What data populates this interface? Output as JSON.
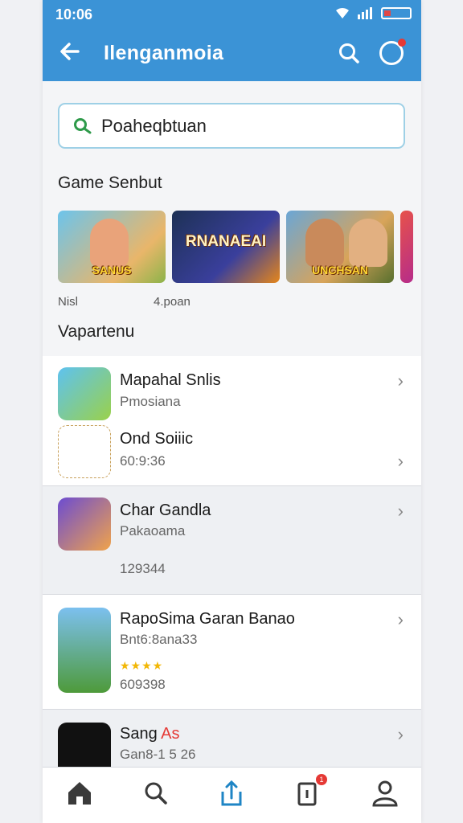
{
  "status": {
    "time": "10:06"
  },
  "header": {
    "title": "Ilenganmoia"
  },
  "search": {
    "value": "Poaheqbtuan"
  },
  "featured": {
    "title": "Game Senbut",
    "items": [
      {
        "label": "SANUS"
      },
      {
        "label": "RNANAEAI"
      },
      {
        "label": "UNCHSAN"
      }
    ],
    "meta_left": "Nisl",
    "meta_right": "4.poan"
  },
  "list_section": {
    "title": "Vapartenu"
  },
  "list": [
    {
      "name": "Mapahal Snlis",
      "sub": "Pmosiana",
      "extra": ""
    },
    {
      "name": "Ond Soiiic",
      "sub": "60:9:36",
      "extra": ""
    },
    {
      "name": "Char Gandla",
      "sub": "Pakaoama",
      "extra": "129344"
    },
    {
      "name": "RapoSima Garan Banao",
      "sub": "Bnt6:8ana33",
      "extra": "609398",
      "stars": "★★★★"
    },
    {
      "name": "Sang",
      "name_accent": "As",
      "sub": "Gan8-1 5 26",
      "extra": ""
    }
  ],
  "colors": {
    "accent": "#3b93d6",
    "badge": "#e53935"
  },
  "nav": {
    "badge_count": "1"
  }
}
